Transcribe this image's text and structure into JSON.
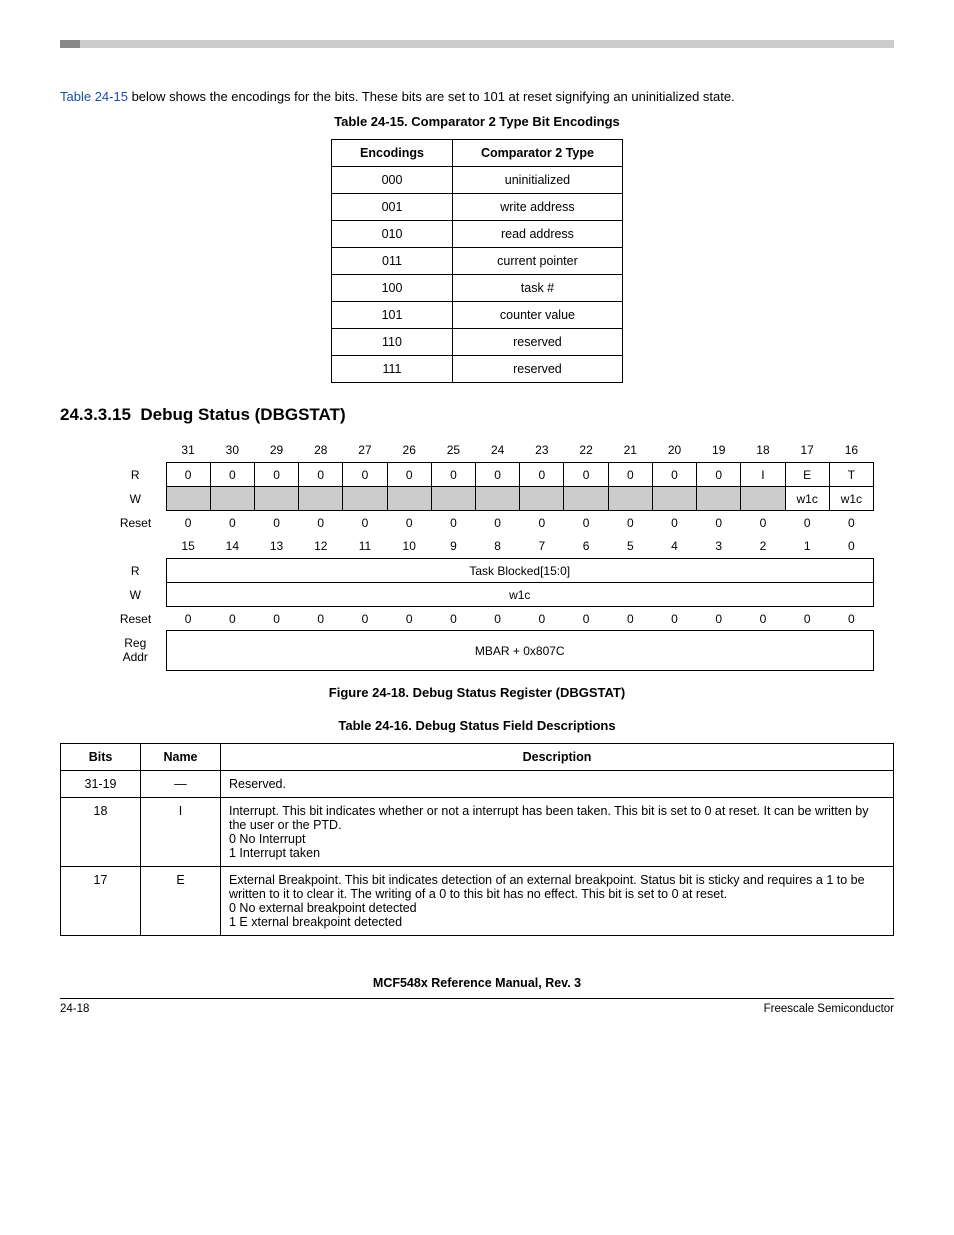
{
  "intro": {
    "link_text": "Table 24-15",
    "rest": " below shows the encodings for the bits. These bits are set to 101 at reset signifying an uninitialized state."
  },
  "table15": {
    "caption": "Table 24-15. Comparator 2 Type Bit Encodings",
    "head": {
      "c1": "Encodings",
      "c2": "Comparator 2 Type"
    },
    "rows": [
      {
        "c1": "000",
        "c2": "uninitialized"
      },
      {
        "c1": "001",
        "c2": "write address"
      },
      {
        "c1": "010",
        "c2": "read address"
      },
      {
        "c1": "011",
        "c2": "current pointer"
      },
      {
        "c1": "100",
        "c2": "task #"
      },
      {
        "c1": "101",
        "c2": "counter value"
      },
      {
        "c1": "110",
        "c2": "reserved"
      },
      {
        "c1": "111",
        "c2": "reserved"
      }
    ]
  },
  "section": {
    "num": "24.3.3.15",
    "title": "Debug Status (DBGSTAT)"
  },
  "reg": {
    "bits_hi": [
      "31",
      "30",
      "29",
      "28",
      "27",
      "26",
      "25",
      "24",
      "23",
      "22",
      "21",
      "20",
      "19",
      "18",
      "17",
      "16"
    ],
    "r_hi": [
      "0",
      "0",
      "0",
      "0",
      "0",
      "0",
      "0",
      "0",
      "0",
      "0",
      "0",
      "0",
      "0",
      "I",
      "E",
      "T"
    ],
    "w_hi_17": "w1c",
    "w_hi_16": "w1c",
    "reset_hi": [
      "0",
      "0",
      "0",
      "0",
      "0",
      "0",
      "0",
      "0",
      "0",
      "0",
      "0",
      "0",
      "0",
      "0",
      "0",
      "0"
    ],
    "bits_lo": [
      "15",
      "14",
      "13",
      "12",
      "11",
      "10",
      "9",
      "8",
      "7",
      "6",
      "5",
      "4",
      "3",
      "2",
      "1",
      "0"
    ],
    "r_lo": "Task Blocked[15:0]",
    "w_lo": "w1c",
    "reset_lo": [
      "0",
      "0",
      "0",
      "0",
      "0",
      "0",
      "0",
      "0",
      "0",
      "0",
      "0",
      "0",
      "0",
      "0",
      "0",
      "0"
    ],
    "regaddr": "MBAR + 0x807C",
    "labels": {
      "R": "R",
      "W": "W",
      "Reset": "Reset",
      "RegAddr1": "Reg",
      "RegAddr2": "Addr"
    }
  },
  "fig_caption": "Figure 24-18. Debug Status Register (DBGSTAT)",
  "table16": {
    "caption": "Table 24-16. Debug Status Field Descriptions",
    "head": {
      "c1": "Bits",
      "c2": "Name",
      "c3": "Description"
    },
    "rows": [
      {
        "bits": "31-19",
        "name": "—",
        "desc": "Reserved."
      },
      {
        "bits": "18",
        "name": "I",
        "desc": "Interrupt. This bit indicates whether or not a interrupt has been taken. This bit is set to 0 at reset. It can be written by the user or the PTD.\n0  No Interrupt\n1  Interrupt taken"
      },
      {
        "bits": "17",
        "name": "E",
        "desc": "External Breakpoint. This bit indicates detection of an external breakpoint. Status bit is sticky and requires a 1 to be written to it to clear it. The writing of a 0 to this bit has no effect. This bit is set to 0 at reset.\n0  No external breakpoint detected\n1  E xternal breakpoint detected"
      }
    ]
  },
  "footer": {
    "center": "MCF548x Reference Manual, Rev. 3",
    "left": "24-18",
    "right": "Freescale Semiconductor"
  }
}
